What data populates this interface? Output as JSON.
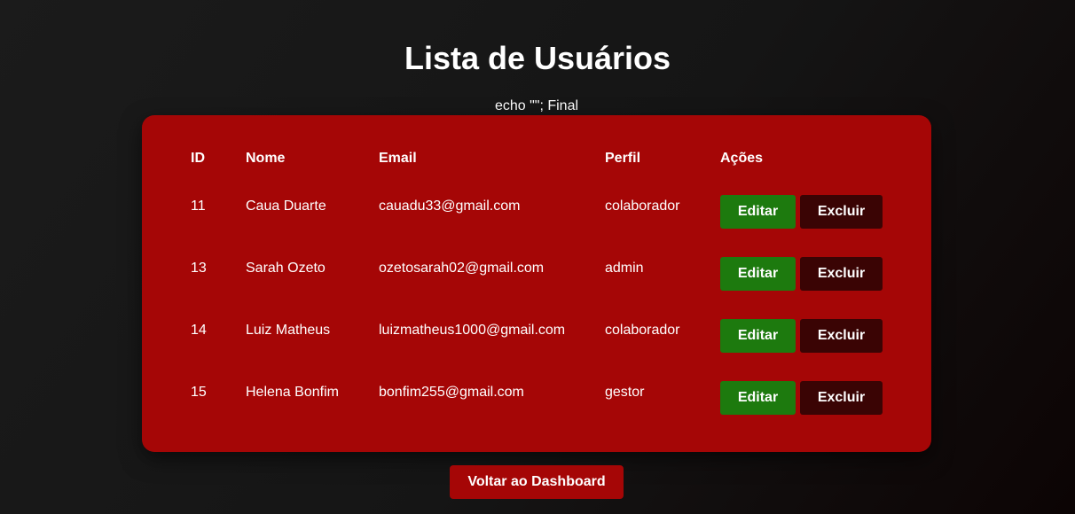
{
  "page": {
    "title": "Lista de Usuários",
    "debug_text": "echo \"\"; Final"
  },
  "table": {
    "headers": {
      "id": "ID",
      "name": "Nome",
      "email": "Email",
      "profile": "Perfil",
      "actions": "Ações"
    },
    "rows": [
      {
        "id": "11",
        "name": "Caua Duarte",
        "email": "cauadu33@gmail.com",
        "profile": "colaborador"
      },
      {
        "id": "13",
        "name": "Sarah Ozeto",
        "email": "ozetosarah02@gmail.com",
        "profile": "admin"
      },
      {
        "id": "14",
        "name": "Luiz Matheus",
        "email": "luizmatheus1000@gmail.com",
        "profile": "colaborador"
      },
      {
        "id": "15",
        "name": "Helena Bonfim",
        "email": "bonfim255@gmail.com",
        "profile": "gestor"
      }
    ],
    "actions": {
      "edit_label": "Editar",
      "delete_label": "Excluir"
    }
  },
  "footer": {
    "back_label": "Voltar ao Dashboard"
  },
  "colors": {
    "background": "#151515",
    "card": "#a50606",
    "edit_button": "#1d7a0e",
    "delete_button": "#3a0404",
    "text": "#ffffff"
  }
}
